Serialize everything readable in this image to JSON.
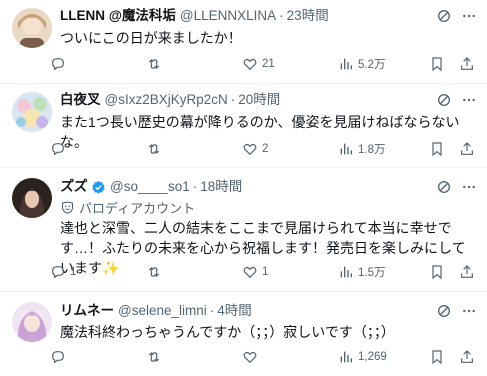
{
  "posts": [
    {
      "name": "LLENN @魔法科垢",
      "handle": "@LLENNXLINA",
      "time": "23時間",
      "text": "ついにこの日が来ましたか！",
      "replies": "",
      "reposts": "",
      "likes": "21",
      "views": "5.2万"
    },
    {
      "name": "白夜叉",
      "handle": "@sIxz2BXjKyRp2cN",
      "time": "20時間",
      "text": "また1つ長い歴史の幕が降りるのか、優姿を見届けねばならないな。",
      "replies": "",
      "reposts": "",
      "likes": "2",
      "views": "1.8万"
    },
    {
      "name": "ス゚ス゚",
      "handle": "@so____so1",
      "time": "18時間",
      "parody": "パロディアカウント",
      "text": "達也と深雪、二人の結末をここまで見届けられて本当に幸せです…！ふたりの未来を心から祝福します！発売日を楽しみにしています",
      "sparkle": "✨",
      "replies": "1",
      "reposts": "",
      "likes": "1",
      "views": "1.5万"
    },
    {
      "name": "リムネー",
      "handle": "@selene_limni",
      "time": "4時間",
      "text": "魔法科終わっちゃうんですか（；；）寂しいです（；；）",
      "replies": "",
      "reposts": "",
      "likes": "",
      "views": "1,269"
    }
  ],
  "dot": "·",
  "colors": {
    "text": "#0f1419",
    "muted": "#536471",
    "verified": "#1d9bf0",
    "divider": "#eff3f4"
  }
}
